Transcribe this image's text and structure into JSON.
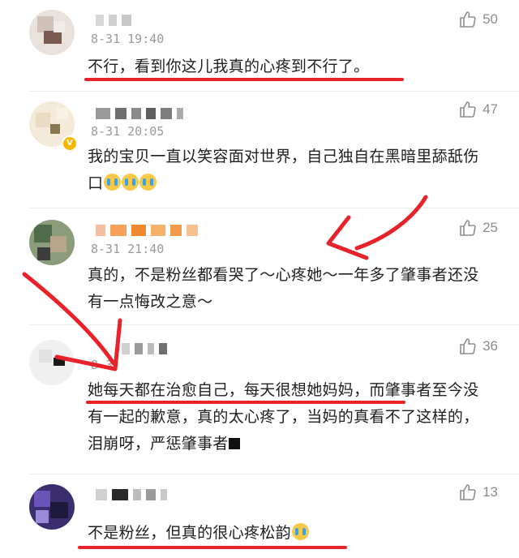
{
  "comments": [
    {
      "timestamp": "8-31 19:40",
      "text": "不行，看到你这儿我真的心疼到不行了。",
      "likes": "50"
    },
    {
      "timestamp": "8-31 20:05",
      "text": "我的宝贝一直以笑容面对世界，自己独自在黑暗里舔舐伤口",
      "likes": "47"
    },
    {
      "timestamp": "8-31 21:40",
      "text": "真的，不是粉丝都看哭了～心疼她～一年多了肇事者还没有一点悔改之意～",
      "likes": "25"
    },
    {
      "timestamp": "8-3",
      "text_part1": "她每天都在治愈自己，每天很想她妈妈，而肇事者至今没有一起的歉意，真的太心疼了，当妈的真看不了这样的，泪崩呀，严惩肇事者",
      "likes": "36"
    },
    {
      "timestamp": "",
      "text": "不是粉丝，但真的很心疼松韵",
      "likes": "13"
    }
  ],
  "icons": {
    "like": "thumbs-up-icon",
    "emoji": "crying-face-emoji"
  },
  "colors": {
    "annotation_red": "#e8222a",
    "timestamp_gray": "#9a9a9a",
    "like_gray": "#8d8d8d"
  }
}
